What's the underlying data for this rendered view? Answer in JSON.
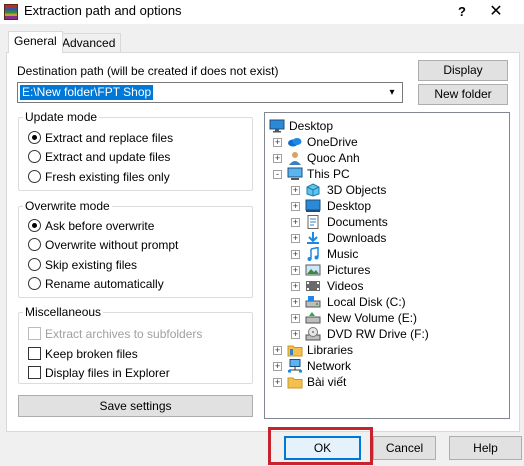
{
  "window": {
    "title": "Extraction path and options",
    "help_glyph": "?",
    "close_glyph": "✕"
  },
  "tabs": [
    "General",
    "Advanced"
  ],
  "destination": {
    "label": "Destination path (will be created if does not exist)",
    "value": "E:\\New folder\\FPT Shop"
  },
  "buttons": {
    "display": "Display",
    "new_folder": "New folder",
    "save_settings": "Save settings",
    "ok": "OK",
    "cancel": "Cancel",
    "help": "Help"
  },
  "update_mode": {
    "title": "Update mode",
    "options": [
      {
        "label": "Extract and replace files",
        "selected": true
      },
      {
        "label": "Extract and update files",
        "selected": false
      },
      {
        "label": "Fresh existing files only",
        "selected": false
      }
    ]
  },
  "overwrite_mode": {
    "title": "Overwrite mode",
    "options": [
      {
        "label": "Ask before overwrite",
        "selected": true
      },
      {
        "label": "Overwrite without prompt",
        "selected": false
      },
      {
        "label": "Skip existing files",
        "selected": false
      },
      {
        "label": "Rename automatically",
        "selected": false
      }
    ]
  },
  "miscellaneous": {
    "title": "Miscellaneous",
    "options": [
      {
        "label": "Extract archives to subfolders",
        "checked": false,
        "disabled": true
      },
      {
        "label": "Keep broken files",
        "checked": false,
        "disabled": false
      },
      {
        "label": "Display files in Explorer",
        "checked": false,
        "disabled": false
      }
    ]
  },
  "tree": [
    {
      "label": "Desktop",
      "icon": "desktop-icon",
      "expander": ""
    },
    {
      "label": "OneDrive",
      "icon": "cloud-icon",
      "expander": "+"
    },
    {
      "label": "Quoc Anh",
      "icon": "user-icon",
      "expander": "+"
    },
    {
      "label": "This PC",
      "icon": "computer-icon",
      "expander": "-"
    },
    {
      "label": "3D Objects",
      "icon": "cube-icon",
      "expander": "+"
    },
    {
      "label": "Desktop",
      "icon": "desktop-icon",
      "expander": "+"
    },
    {
      "label": "Documents",
      "icon": "document-icon",
      "expander": "+"
    },
    {
      "label": "Downloads",
      "icon": "download-icon",
      "expander": "+"
    },
    {
      "label": "Music",
      "icon": "music-icon",
      "expander": "+"
    },
    {
      "label": "Pictures",
      "icon": "picture-icon",
      "expander": "+"
    },
    {
      "label": "Videos",
      "icon": "video-icon",
      "expander": "+"
    },
    {
      "label": "Local Disk (C:)",
      "icon": "drive-icon",
      "expander": "+"
    },
    {
      "label": "New Volume (E:)",
      "icon": "drive-icon",
      "expander": "+"
    },
    {
      "label": "DVD RW Drive (F:)",
      "icon": "dvd-icon",
      "expander": "+"
    },
    {
      "label": "Libraries",
      "icon": "folder-icon",
      "expander": "+"
    },
    {
      "label": "Network",
      "icon": "network-icon",
      "expander": "+"
    },
    {
      "label": "Bài viết",
      "icon": "folder-icon",
      "expander": "+"
    }
  ],
  "colors": {
    "selection": "#0078d7",
    "highlight_box": "#c8232c"
  }
}
